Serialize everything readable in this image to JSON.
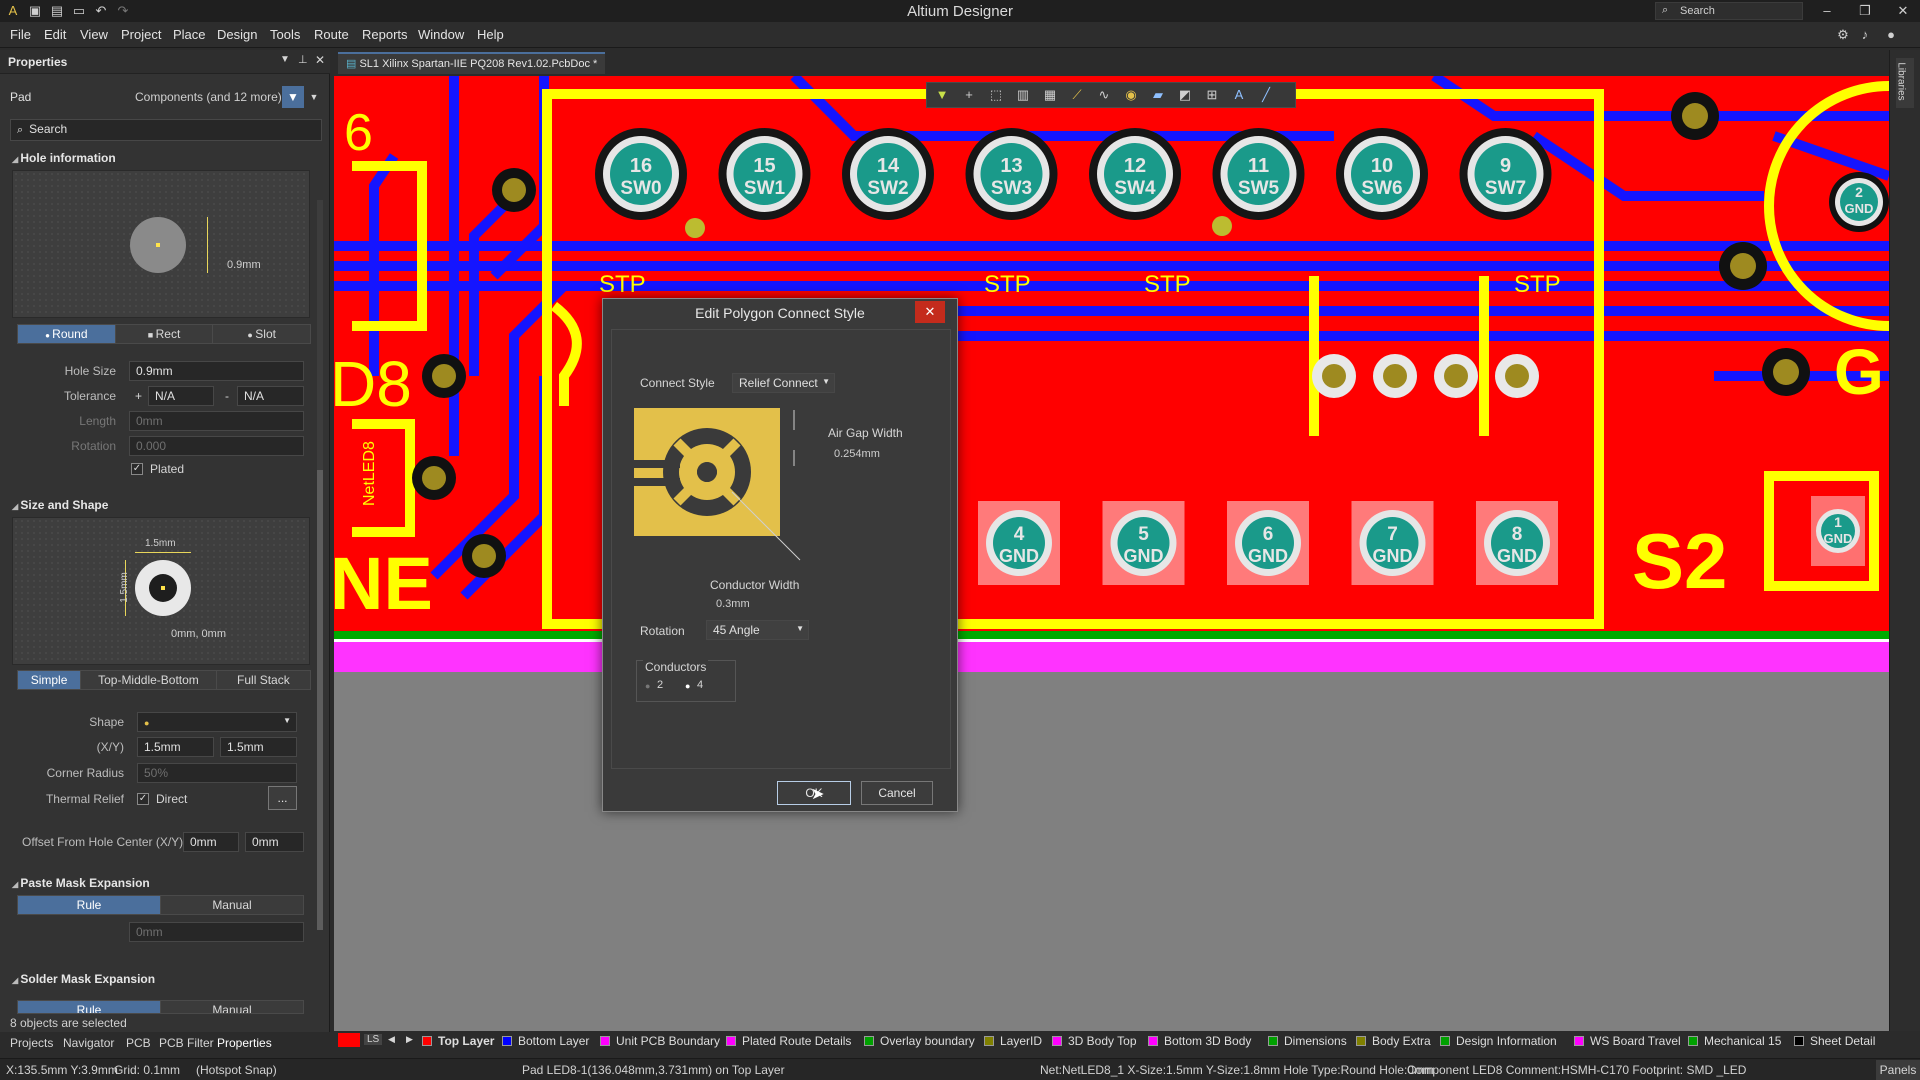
{
  "app": {
    "title": "Altium Designer",
    "search_placeholder": "Search"
  },
  "menu": [
    "File",
    "Edit",
    "View",
    "Project",
    "Place",
    "Design",
    "Tools",
    "Route",
    "Reports",
    "Window",
    "Help"
  ],
  "properties": {
    "panel_title": "Properties",
    "object_type": "Pad",
    "filter_label": "Components (and 12 more)",
    "search_placeholder": "Search",
    "hole_info_title": "Hole information",
    "hole_preview_dim": "0.9mm",
    "hole_shapes": [
      "Round",
      "Rect",
      "Slot"
    ],
    "hole_shape_selected": "Round",
    "hole_size_label": "Hole Size",
    "hole_size": "0.9mm",
    "tolerance_label": "Tolerance",
    "tolerance_plus": "N/A",
    "tolerance_minus": "N/A",
    "plus_sign": "+",
    "minus_sign": "-",
    "length_label": "Length",
    "length": "0mm",
    "rotation_label": "Rotation",
    "rotation": "0.000",
    "plated_label": "Plated",
    "plated": true,
    "size_shape_title": "Size and Shape",
    "size_preview_w": "1.5mm",
    "size_preview_h": "1.5mm",
    "size_preview_offset": "0mm, 0mm",
    "stack_modes": [
      "Simple",
      "Top-Middle-Bottom",
      "Full Stack"
    ],
    "stack_mode_selected": "Simple",
    "shape_label": "Shape",
    "xy_label": "(X/Y)",
    "size_x": "1.5mm",
    "size_y": "1.5mm",
    "corner_radius_label": "Corner Radius",
    "corner_radius": "50%",
    "thermal_relief_label": "Thermal Relief",
    "thermal_relief_value": "Direct",
    "ellipsis": "...",
    "offset_label": "Offset From Hole Center (X/Y)",
    "offset_x": "0mm",
    "offset_y": "0mm",
    "paste_mask_title": "Paste Mask Expansion",
    "paste_mask_modes": [
      "Rule",
      "Manual"
    ],
    "paste_mask_value": "0mm",
    "solder_mask_title": "Solder Mask Expansion",
    "solder_mask_modes": [
      "Rule",
      "Manual"
    ],
    "selection_count": "8 objects are selected"
  },
  "panel_tabs": [
    "Projects",
    "Navigator",
    "PCB",
    "PCB Filter",
    "Properties"
  ],
  "document_tab": "SL1 Xilinx Spartan-IIE PQ208 Rev1.02.PcbDoc *",
  "right_strip_label": "Libraries",
  "pcb": {
    "sw_pads": [
      {
        "num": "16",
        "name": "SW0"
      },
      {
        "num": "15",
        "name": "SW1"
      },
      {
        "num": "14",
        "name": "SW2"
      },
      {
        "num": "13",
        "name": "SW3"
      },
      {
        "num": "12",
        "name": "SW4"
      },
      {
        "num": "11",
        "name": "SW5"
      },
      {
        "num": "10",
        "name": "SW6"
      },
      {
        "num": "9",
        "name": "SW7"
      }
    ],
    "gnd_pads": [
      {
        "num": "4",
        "name": "GND"
      },
      {
        "num": "5",
        "name": "GND"
      },
      {
        "num": "6",
        "name": "GND"
      },
      {
        "num": "7",
        "name": "GND"
      },
      {
        "num": "8",
        "name": "GND"
      }
    ],
    "right_pad_top": {
      "num": "2",
      "name": "GND"
    },
    "right_pad_bottom": {
      "num": "1",
      "name": "GND"
    },
    "labels": {
      "stp": "STP",
      "s2": "S2",
      "g": "G",
      "d8": "D8",
      "ne": "NE",
      "six": "6",
      "net_led": "NetLED8",
      "one": "1"
    }
  },
  "dialog": {
    "title": "Edit Polygon Connect Style",
    "connect_style_label": "Connect Style",
    "connect_style_value": "Relief Connect",
    "air_gap_label": "Air Gap Width",
    "air_gap_value": "0.254mm",
    "conductor_width_label": "Conductor Width",
    "conductor_width_value": "0.3mm",
    "rotation_label": "Rotation",
    "rotation_value": "45 Angle",
    "conductors_label": "Conductors",
    "conductor_options": [
      "2",
      "4"
    ],
    "conductors_selected": "4",
    "ok_label": "OK",
    "cancel_label": "Cancel"
  },
  "layers": {
    "ls_label": "LS",
    "items": [
      {
        "name": "Top Layer",
        "color": "#ff0000",
        "active": true
      },
      {
        "name": "Bottom Layer",
        "color": "#0000ff"
      },
      {
        "name": "Unit PCB Boundary",
        "color": "#ff00ff"
      },
      {
        "name": "Plated Route Details",
        "color": "#ff00ff"
      },
      {
        "name": "Overlay boundary",
        "color": "#00a000"
      },
      {
        "name": "LayerID",
        "color": "#808000"
      },
      {
        "name": "3D Body Top",
        "color": "#ff00ff"
      },
      {
        "name": "Bottom 3D Body",
        "color": "#ff00ff"
      },
      {
        "name": "Dimensions",
        "color": "#00a000"
      },
      {
        "name": "Body Extra",
        "color": "#808000"
      },
      {
        "name": "Design Information",
        "color": "#00a000"
      },
      {
        "name": "WS Board Travel",
        "color": "#ff00ff"
      },
      {
        "name": "Mechanical 15",
        "color": "#00a000"
      },
      {
        "name": "Sheet Detail",
        "color": "#000000"
      }
    ]
  },
  "status": {
    "coords": "X:135.5mm Y:3.9mm",
    "grid": "Grid: 0.1mm",
    "snap": "(Hotspot Snap)",
    "pad_info": "Pad LED8-1(136.048mm,3.731mm) on Top Layer",
    "net_info": "Net:NetLED8_1 X-Size:1.5mm Y-Size:1.8mm Hole Type:Round Hole:0mm",
    "component_info": "Component LED8 Comment:HSMH-C170 Footprint: SMD _LED",
    "panels_label": "Panels"
  },
  "colors": {
    "copper_top": "#ff0000",
    "copper_bottom": "#1a1aff",
    "overlay": "#ffff00",
    "pad_teal": "#1a9a8a",
    "accent_blue": "#4b6f9c"
  }
}
